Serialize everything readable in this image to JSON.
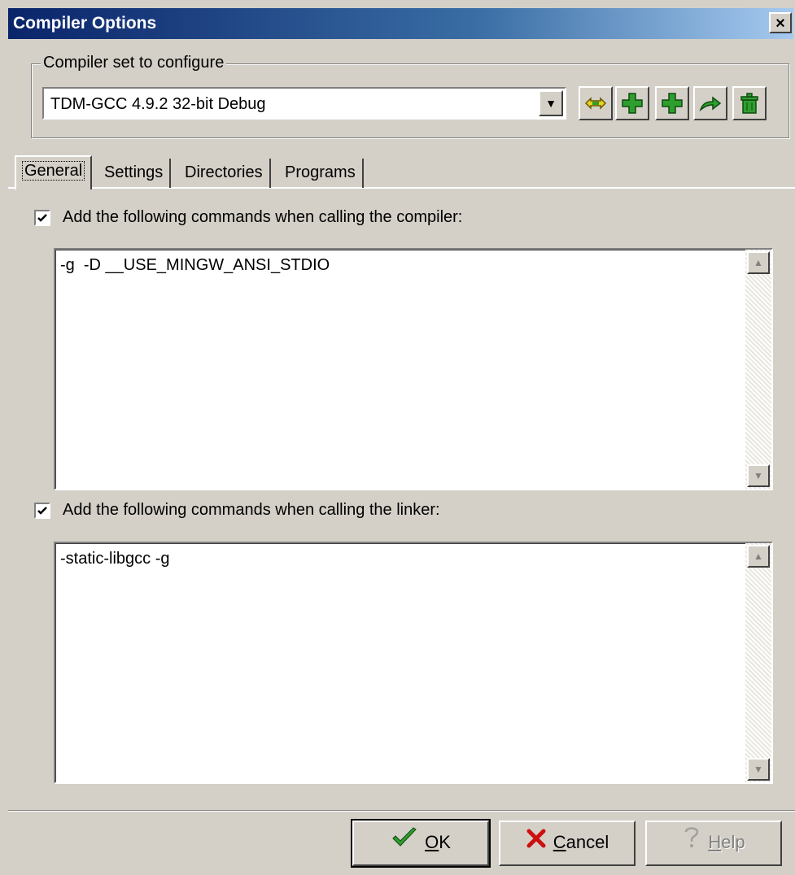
{
  "window": {
    "title": "Compiler Options",
    "close_label": "×"
  },
  "compiler_set": {
    "group_label": "Compiler set to configure",
    "selected": "TDM-GCC 4.9.2 32-bit Debug"
  },
  "toolbar": {
    "buttons": [
      {
        "icon": "rename-icon"
      },
      {
        "icon": "add-compiler-icon"
      },
      {
        "icon": "add-folder-icon"
      },
      {
        "icon": "find-compiler-icon"
      },
      {
        "icon": "delete-compiler-icon"
      }
    ]
  },
  "tabs": [
    {
      "label": "General",
      "active": true
    },
    {
      "label": "Settings",
      "active": false
    },
    {
      "label": "Directories",
      "active": false
    },
    {
      "label": "Programs",
      "active": false
    }
  ],
  "general": {
    "compiler_check_label": "Add the following commands when calling the compiler:",
    "compiler_checked": true,
    "compiler_commands": "-g  -D __USE_MINGW_ANSI_STDIO",
    "linker_check_label": "Add the following commands when calling the linker:",
    "linker_checked": true,
    "linker_commands": "-static-libgcc -g"
  },
  "buttons": {
    "ok": {
      "label": "OK",
      "accel": "O"
    },
    "cancel": {
      "label": "Cancel",
      "accel": "C"
    },
    "help": {
      "label": "Help",
      "accel": "H",
      "disabled": true
    }
  },
  "colors": {
    "titlebar_start": "#0a246a",
    "face": "#d4d0c8",
    "icon_green": "#2e9e2e",
    "icon_yellow": "#e8d020"
  }
}
